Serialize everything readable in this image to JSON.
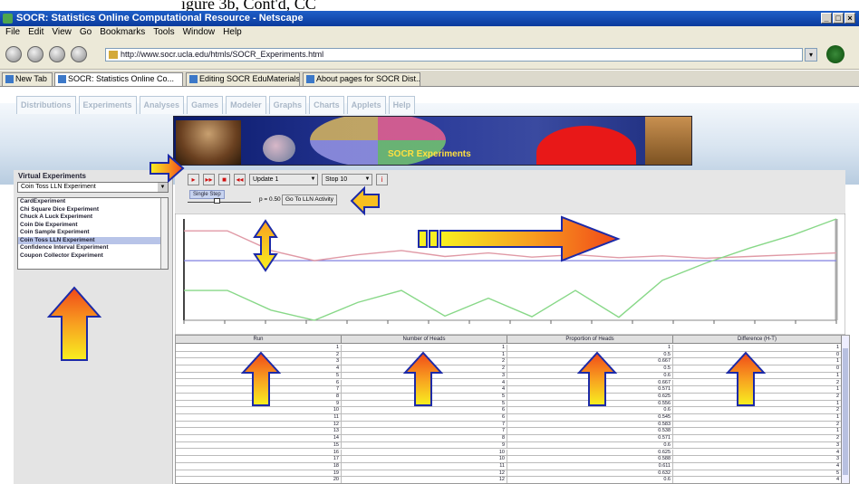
{
  "caption": "igure 3b, Cont'd, CC",
  "window": {
    "title": "SOCR: Statistics Online Computational Resource - Netscape",
    "controls": [
      "_",
      "□",
      "×"
    ]
  },
  "menu": [
    "File",
    "Edit",
    "View",
    "Go",
    "Bookmarks",
    "Tools",
    "Window",
    "Help"
  ],
  "address": {
    "url": "http://www.socr.ucla.edu/htmls/SOCR_Experiments.html"
  },
  "browser_tabs": [
    {
      "label": "New Tab",
      "active": false
    },
    {
      "label": "SOCR: Statistics Online Co...",
      "active": true
    },
    {
      "label": "Editing SOCR EduMaterials ...",
      "active": false
    },
    {
      "label": "About pages for SOCR Dist...",
      "active": false
    }
  ],
  "app_tabs": [
    "Distributions",
    "Experiments",
    "Analyses",
    "Games",
    "Modeler",
    "Graphs",
    "Charts",
    "Applets",
    "Help"
  ],
  "banner": {
    "title": "SOCR Experiments"
  },
  "left_panel": {
    "label": "Virtual Experiments",
    "selected": "Coin Toss LLN Experiment",
    "experiments": [
      "CardExperiment",
      "Chi Square Dice Experiment",
      "Chuck A Luck Experiment",
      "Coin Die Experiment",
      "Coin Sample Experiment",
      "Coin Toss LLN Experiment",
      "Confidence Interval Experiment",
      "Coupon Collector Experiment"
    ],
    "selected_index": 5
  },
  "toolbar": {
    "buttons": [
      "▸",
      "▸▸",
      "■",
      "◂◂"
    ],
    "update_select": "Update 1",
    "stop_select": "Stop 10",
    "info_button": "i",
    "single_step": "Single Step",
    "p_value": "p = 0.50",
    "goto_button": "Go To LLN Activity"
  },
  "chart_data": {
    "type": "line",
    "series": [
      {
        "color": "#e09aa6",
        "values": [
          1.0,
          1.0,
          0.67,
          0.5,
          0.6,
          0.67,
          0.57,
          0.63,
          0.56,
          0.6,
          0.55,
          0.58,
          0.54,
          0.57,
          0.6,
          0.63
        ]
      },
      {
        "color": "#88d888",
        "values": [
          0.0,
          0.0,
          -0.33,
          -0.5,
          -0.2,
          0.0,
          -0.43,
          -0.13,
          -0.44,
          0.0,
          -0.45,
          0.17,
          0.46,
          0.71,
          0.93,
          1.25
        ]
      }
    ],
    "reference_line": 0.5,
    "x_ticks": 17
  },
  "table": {
    "headers": [
      "Run",
      "Number of Heads",
      "Proportion of Heads",
      "Difference (H-T)"
    ],
    "rows": [
      [
        "1",
        "1",
        "1",
        "1"
      ],
      [
        "2",
        "1",
        "0.5",
        "0"
      ],
      [
        "3",
        "2",
        "0.667",
        "1"
      ],
      [
        "4",
        "2",
        "0.5",
        "0"
      ],
      [
        "5",
        "3",
        "0.6",
        "1"
      ],
      [
        "6",
        "4",
        "0.667",
        "2"
      ],
      [
        "7",
        "4",
        "0.571",
        "1"
      ],
      [
        "8",
        "5",
        "0.625",
        "2"
      ],
      [
        "9",
        "5",
        "0.556",
        "1"
      ],
      [
        "10",
        "6",
        "0.6",
        "2"
      ],
      [
        "11",
        "6",
        "0.545",
        "1"
      ],
      [
        "12",
        "7",
        "0.583",
        "2"
      ],
      [
        "13",
        "7",
        "0.538",
        "1"
      ],
      [
        "14",
        "8",
        "0.571",
        "2"
      ],
      [
        "15",
        "9",
        "0.6",
        "3"
      ],
      [
        "16",
        "10",
        "0.625",
        "4"
      ],
      [
        "17",
        "10",
        "0.588",
        "3"
      ],
      [
        "18",
        "11",
        "0.611",
        "4"
      ],
      [
        "19",
        "12",
        "0.632",
        "5"
      ],
      [
        "20",
        "12",
        "0.6",
        "4"
      ]
    ]
  }
}
